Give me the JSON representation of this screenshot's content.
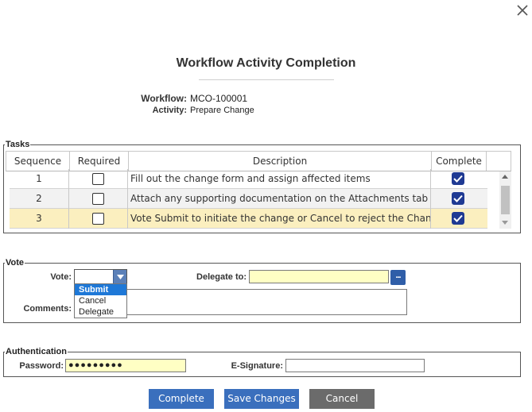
{
  "dialog": {
    "title": "Workflow Activity Completion",
    "close_icon": "close-icon"
  },
  "workflow": {
    "workflow_label": "Workflow:",
    "workflow_value": "MCO-100001",
    "activity_label": "Activity:",
    "activity_value": "Prepare Change"
  },
  "tasks": {
    "legend": "Tasks",
    "columns": [
      "Sequence",
      "Required",
      "Description",
      "Complete"
    ],
    "rows": [
      {
        "sequence": "1",
        "required": false,
        "description": "Fill out the change form and assign affected items",
        "complete": true
      },
      {
        "sequence": "2",
        "required": false,
        "description": "Attach any supporting documentation on the Attachments tab",
        "complete": true
      },
      {
        "sequence": "3",
        "required": false,
        "description": "Vote Submit to initiate the change or Cancel to reject the Change",
        "complete": true,
        "selected": true
      }
    ]
  },
  "vote": {
    "legend": "Vote",
    "vote_label": "Vote:",
    "vote_value": "",
    "options": [
      "Submit",
      "Cancel",
      "Delegate"
    ],
    "highlighted_option": "Submit",
    "delegate_label": "Delegate to:",
    "delegate_value": "",
    "delegate_button": "...",
    "comments_label": "Comments:",
    "comments_value": ""
  },
  "auth": {
    "legend": "Authentication",
    "password_label": "Password:",
    "password_value": "●●●●●●●●●",
    "esig_label": "E-Signature:",
    "esig_value": ""
  },
  "buttons": {
    "complete": "Complete",
    "save": "Save Changes",
    "cancel": "Cancel"
  },
  "colors": {
    "primary": "#3a6fbd",
    "secondary": "#6b6b6b",
    "highlight_row": "#fbefbf",
    "required_field": "#ffffc4",
    "checkbox_checked": "#1f3a93"
  }
}
